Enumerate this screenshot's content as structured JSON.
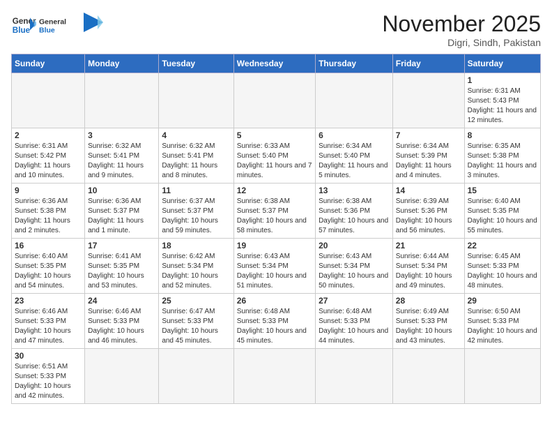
{
  "header": {
    "logo_general": "General",
    "logo_blue": "Blue",
    "title": "November 2025",
    "subtitle": "Digri, Sindh, Pakistan"
  },
  "weekdays": [
    "Sunday",
    "Monday",
    "Tuesday",
    "Wednesday",
    "Thursday",
    "Friday",
    "Saturday"
  ],
  "weeks": [
    [
      {
        "day": "",
        "info": ""
      },
      {
        "day": "",
        "info": ""
      },
      {
        "day": "",
        "info": ""
      },
      {
        "day": "",
        "info": ""
      },
      {
        "day": "",
        "info": ""
      },
      {
        "day": "",
        "info": ""
      },
      {
        "day": "1",
        "info": "Sunrise: 6:31 AM\nSunset: 5:43 PM\nDaylight: 11 hours and 12 minutes."
      }
    ],
    [
      {
        "day": "2",
        "info": "Sunrise: 6:31 AM\nSunset: 5:42 PM\nDaylight: 11 hours and 10 minutes."
      },
      {
        "day": "3",
        "info": "Sunrise: 6:32 AM\nSunset: 5:41 PM\nDaylight: 11 hours and 9 minutes."
      },
      {
        "day": "4",
        "info": "Sunrise: 6:32 AM\nSunset: 5:41 PM\nDaylight: 11 hours and 8 minutes."
      },
      {
        "day": "5",
        "info": "Sunrise: 6:33 AM\nSunset: 5:40 PM\nDaylight: 11 hours and 7 minutes."
      },
      {
        "day": "6",
        "info": "Sunrise: 6:34 AM\nSunset: 5:40 PM\nDaylight: 11 hours and 5 minutes."
      },
      {
        "day": "7",
        "info": "Sunrise: 6:34 AM\nSunset: 5:39 PM\nDaylight: 11 hours and 4 minutes."
      },
      {
        "day": "8",
        "info": "Sunrise: 6:35 AM\nSunset: 5:38 PM\nDaylight: 11 hours and 3 minutes."
      }
    ],
    [
      {
        "day": "9",
        "info": "Sunrise: 6:36 AM\nSunset: 5:38 PM\nDaylight: 11 hours and 2 minutes."
      },
      {
        "day": "10",
        "info": "Sunrise: 6:36 AM\nSunset: 5:37 PM\nDaylight: 11 hours and 1 minute."
      },
      {
        "day": "11",
        "info": "Sunrise: 6:37 AM\nSunset: 5:37 PM\nDaylight: 10 hours and 59 minutes."
      },
      {
        "day": "12",
        "info": "Sunrise: 6:38 AM\nSunset: 5:37 PM\nDaylight: 10 hours and 58 minutes."
      },
      {
        "day": "13",
        "info": "Sunrise: 6:38 AM\nSunset: 5:36 PM\nDaylight: 10 hours and 57 minutes."
      },
      {
        "day": "14",
        "info": "Sunrise: 6:39 AM\nSunset: 5:36 PM\nDaylight: 10 hours and 56 minutes."
      },
      {
        "day": "15",
        "info": "Sunrise: 6:40 AM\nSunset: 5:35 PM\nDaylight: 10 hours and 55 minutes."
      }
    ],
    [
      {
        "day": "16",
        "info": "Sunrise: 6:40 AM\nSunset: 5:35 PM\nDaylight: 10 hours and 54 minutes."
      },
      {
        "day": "17",
        "info": "Sunrise: 6:41 AM\nSunset: 5:35 PM\nDaylight: 10 hours and 53 minutes."
      },
      {
        "day": "18",
        "info": "Sunrise: 6:42 AM\nSunset: 5:34 PM\nDaylight: 10 hours and 52 minutes."
      },
      {
        "day": "19",
        "info": "Sunrise: 6:43 AM\nSunset: 5:34 PM\nDaylight: 10 hours and 51 minutes."
      },
      {
        "day": "20",
        "info": "Sunrise: 6:43 AM\nSunset: 5:34 PM\nDaylight: 10 hours and 50 minutes."
      },
      {
        "day": "21",
        "info": "Sunrise: 6:44 AM\nSunset: 5:34 PM\nDaylight: 10 hours and 49 minutes."
      },
      {
        "day": "22",
        "info": "Sunrise: 6:45 AM\nSunset: 5:33 PM\nDaylight: 10 hours and 48 minutes."
      }
    ],
    [
      {
        "day": "23",
        "info": "Sunrise: 6:46 AM\nSunset: 5:33 PM\nDaylight: 10 hours and 47 minutes."
      },
      {
        "day": "24",
        "info": "Sunrise: 6:46 AM\nSunset: 5:33 PM\nDaylight: 10 hours and 46 minutes."
      },
      {
        "day": "25",
        "info": "Sunrise: 6:47 AM\nSunset: 5:33 PM\nDaylight: 10 hours and 45 minutes."
      },
      {
        "day": "26",
        "info": "Sunrise: 6:48 AM\nSunset: 5:33 PM\nDaylight: 10 hours and 45 minutes."
      },
      {
        "day": "27",
        "info": "Sunrise: 6:48 AM\nSunset: 5:33 PM\nDaylight: 10 hours and 44 minutes."
      },
      {
        "day": "28",
        "info": "Sunrise: 6:49 AM\nSunset: 5:33 PM\nDaylight: 10 hours and 43 minutes."
      },
      {
        "day": "29",
        "info": "Sunrise: 6:50 AM\nSunset: 5:33 PM\nDaylight: 10 hours and 42 minutes."
      }
    ],
    [
      {
        "day": "30",
        "info": "Sunrise: 6:51 AM\nSunset: 5:33 PM\nDaylight: 10 hours and 42 minutes."
      },
      {
        "day": "",
        "info": ""
      },
      {
        "day": "",
        "info": ""
      },
      {
        "day": "",
        "info": ""
      },
      {
        "day": "",
        "info": ""
      },
      {
        "day": "",
        "info": ""
      },
      {
        "day": "",
        "info": ""
      }
    ]
  ]
}
